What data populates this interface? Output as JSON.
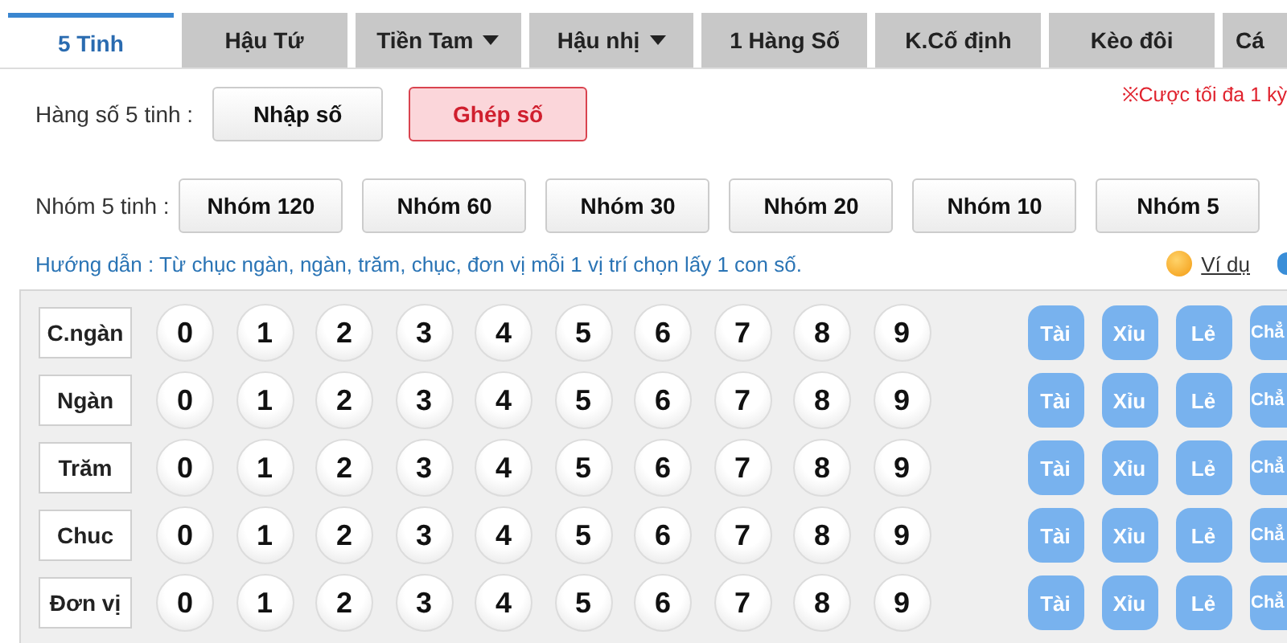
{
  "tabs": [
    {
      "label": "5 Tinh",
      "selected": true,
      "dropdown": false
    },
    {
      "label": "Hậu Tứ",
      "selected": false,
      "dropdown": false
    },
    {
      "label": "Tiền Tam",
      "selected": false,
      "dropdown": true
    },
    {
      "label": "Hậu nhị",
      "selected": false,
      "dropdown": true
    },
    {
      "label": "1 Hàng Số",
      "selected": false,
      "dropdown": false
    },
    {
      "label": "K.Cố định",
      "selected": false,
      "dropdown": false
    },
    {
      "label": "Kèo đôi",
      "selected": false,
      "dropdown": false
    },
    {
      "label": "Cá",
      "selected": false,
      "dropdown": false
    }
  ],
  "mode": {
    "label": "Hàng số 5 tinh :",
    "options": [
      {
        "label": "Nhập số",
        "selected": false
      },
      {
        "label": "Ghép số",
        "selected": true
      }
    ]
  },
  "notice": "※Cược tối đa 1 kỳ",
  "groups": {
    "label": "Nhóm 5 tinh :",
    "options": [
      {
        "label": "Nhóm 120",
        "selected": false
      },
      {
        "label": "Nhóm 60",
        "selected": false
      },
      {
        "label": "Nhóm 30",
        "selected": false
      },
      {
        "label": "Nhóm 20",
        "selected": false
      },
      {
        "label": "Nhóm 10",
        "selected": false
      },
      {
        "label": "Nhóm 5",
        "selected": false
      }
    ]
  },
  "guide": "Hướng dẫn : Từ chục ngàn, ngàn, trăm, chục, đơn vị mỗi 1 vị trí chọn lấy 1 con số.",
  "example_link": "Ví dụ",
  "positions": [
    {
      "label": "C.ngàn",
      "digits": [
        {
          "label": "0",
          "selected": false
        },
        {
          "label": "1",
          "selected": false
        },
        {
          "label": "2",
          "selected": false
        },
        {
          "label": "3",
          "selected": false
        },
        {
          "label": "4",
          "selected": false
        },
        {
          "label": "5",
          "selected": false
        },
        {
          "label": "6",
          "selected": false
        },
        {
          "label": "7",
          "selected": false
        },
        {
          "label": "8",
          "selected": false
        },
        {
          "label": "9",
          "selected": false
        }
      ],
      "quick": [
        "Tài",
        "Xỉu",
        "Lẻ",
        "Chẳ"
      ]
    },
    {
      "label": "Ngàn",
      "digits": [
        {
          "label": "0",
          "selected": false
        },
        {
          "label": "1",
          "selected": false
        },
        {
          "label": "2",
          "selected": false
        },
        {
          "label": "3",
          "selected": false
        },
        {
          "label": "4",
          "selected": false
        },
        {
          "label": "5",
          "selected": false
        },
        {
          "label": "6",
          "selected": false
        },
        {
          "label": "7",
          "selected": false
        },
        {
          "label": "8",
          "selected": false
        },
        {
          "label": "9",
          "selected": false
        }
      ],
      "quick": [
        "Tài",
        "Xỉu",
        "Lẻ",
        "Chẳ"
      ]
    },
    {
      "label": "Trăm",
      "digits": [
        {
          "label": "0",
          "selected": false
        },
        {
          "label": "1",
          "selected": false
        },
        {
          "label": "2",
          "selected": false
        },
        {
          "label": "3",
          "selected": false
        },
        {
          "label": "4",
          "selected": false
        },
        {
          "label": "5",
          "selected": false
        },
        {
          "label": "6",
          "selected": false
        },
        {
          "label": "7",
          "selected": false
        },
        {
          "label": "8",
          "selected": false
        },
        {
          "label": "9",
          "selected": false
        }
      ],
      "quick": [
        "Tài",
        "Xỉu",
        "Lẻ",
        "Chẳ"
      ]
    },
    {
      "label": "Chuc",
      "digits": [
        {
          "label": "0",
          "selected": false
        },
        {
          "label": "1",
          "selected": false
        },
        {
          "label": "2",
          "selected": false
        },
        {
          "label": "3",
          "selected": false
        },
        {
          "label": "4",
          "selected": false
        },
        {
          "label": "5",
          "selected": false
        },
        {
          "label": "6",
          "selected": false
        },
        {
          "label": "7",
          "selected": false
        },
        {
          "label": "8",
          "selected": false
        },
        {
          "label": "9",
          "selected": false
        }
      ],
      "quick": [
        "Tài",
        "Xỉu",
        "Lẻ",
        "Chẳ"
      ]
    },
    {
      "label": "Đơn vị",
      "digits": [
        {
          "label": "0",
          "selected": false
        },
        {
          "label": "1",
          "selected": false
        },
        {
          "label": "2",
          "selected": false
        },
        {
          "label": "3",
          "selected": false
        },
        {
          "label": "4",
          "selected": false
        },
        {
          "label": "5",
          "selected": false
        },
        {
          "label": "6",
          "selected": false
        },
        {
          "label": "7",
          "selected": false
        },
        {
          "label": "8",
          "selected": false
        },
        {
          "label": "9",
          "selected": false
        }
      ],
      "quick": [
        "Tài",
        "Xỉu",
        "Lẻ",
        "Chẳ"
      ]
    }
  ]
}
